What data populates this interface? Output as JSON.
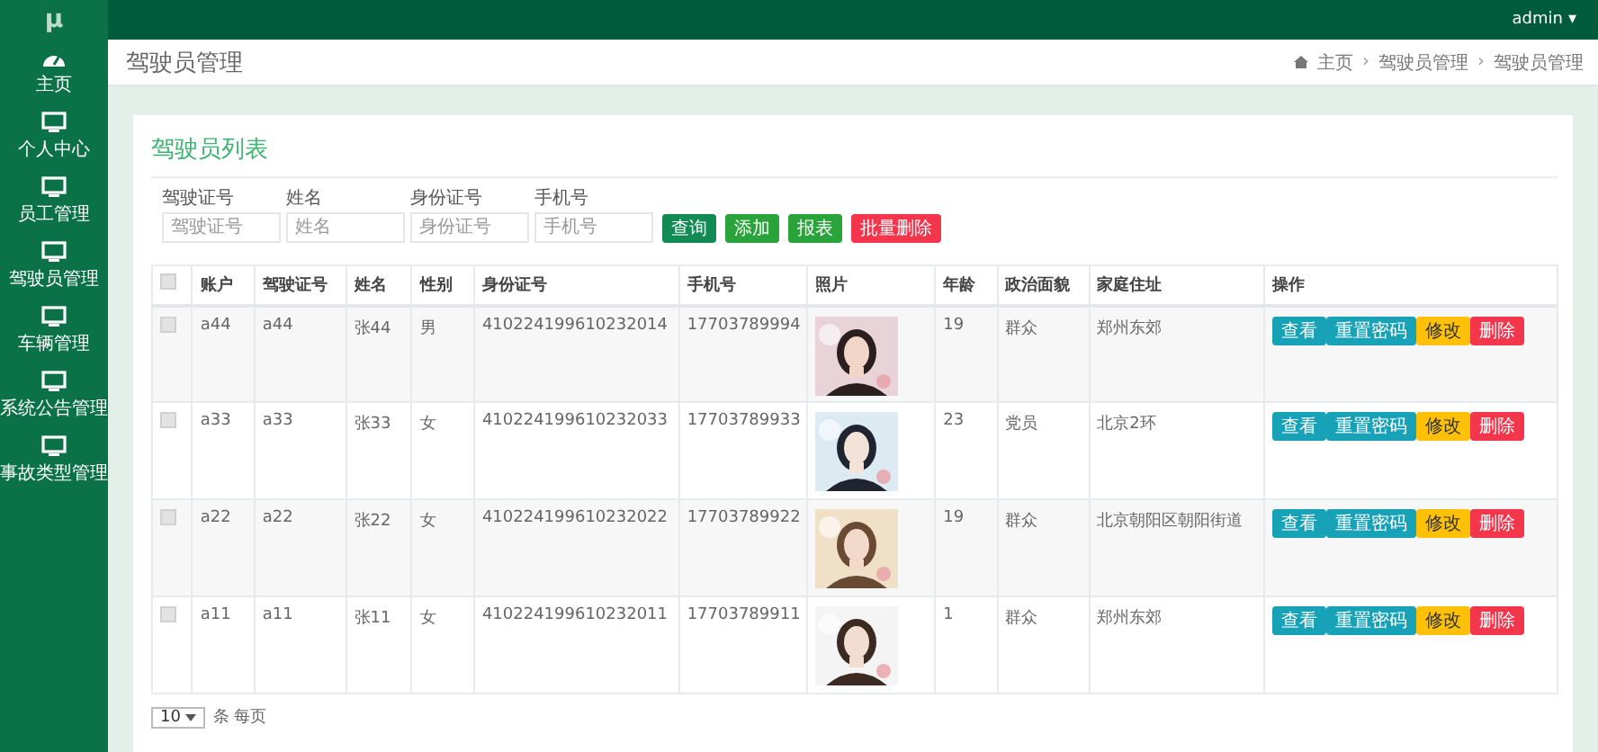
{
  "brand": "μ",
  "user": {
    "name": "admin",
    "caret": "▾"
  },
  "sidebar": [
    {
      "label": "主页",
      "kind": "dashboard"
    },
    {
      "label": "个人中心",
      "kind": "monitor"
    },
    {
      "label": "员工管理",
      "kind": "monitor"
    },
    {
      "label": "驾驶员管理",
      "kind": "monitor"
    },
    {
      "label": "车辆管理",
      "kind": "monitor"
    },
    {
      "label": "系统公告管理",
      "kind": "monitor"
    },
    {
      "label": "事故类型管理",
      "kind": "monitor"
    }
  ],
  "page_title": "驾驶员管理",
  "breadcrumb": {
    "separator": "›",
    "items": [
      "主页",
      "驾驶员管理",
      "驾驶员管理"
    ]
  },
  "card_title": "驾驶员列表",
  "filters": [
    {
      "label": "驾驶证号",
      "placeholder": "驾驶证号"
    },
    {
      "label": "姓名",
      "placeholder": "姓名"
    },
    {
      "label": "身份证号",
      "placeholder": "身份证号"
    },
    {
      "label": "手机号",
      "placeholder": "手机号"
    }
  ],
  "toolbar": [
    {
      "label": "查询",
      "kind": "dark"
    },
    {
      "label": "添加",
      "kind": "green"
    },
    {
      "label": "报表",
      "kind": "green"
    },
    {
      "label": "批量删除",
      "kind": "danger"
    }
  ],
  "table": {
    "select_all": {
      "checked": false
    },
    "columns": [
      "账户",
      "驾驶证号",
      "姓名",
      "性别",
      "身份证号",
      "手机号",
      "照片",
      "年龄",
      "政治面貌",
      "家庭住址",
      "操作"
    ],
    "rows": [
      {
        "checked": false,
        "cells": [
          "a44",
          "a44",
          "张44",
          "男",
          "410224199610232014",
          "17703789994"
        ],
        "photo": {
          "kind": "picture"
        },
        "tail": [
          "19",
          "群众",
          "郑州东郊"
        ],
        "actions": [
          {
            "label": "查看",
            "kind": "info"
          },
          {
            "label": "重置密码",
            "kind": "info"
          },
          {
            "label": "修改",
            "kind": "warning"
          },
          {
            "label": "删除",
            "kind": "danger"
          }
        ]
      },
      {
        "checked": false,
        "cells": [
          "a33",
          "a33",
          "张33",
          "女",
          "410224199610232033",
          "17703789933"
        ],
        "photo": {
          "kind": "picture"
        },
        "tail": [
          "23",
          "党员",
          "北京2环"
        ],
        "actions": [
          {
            "label": "查看",
            "kind": "info"
          },
          {
            "label": "重置密码",
            "kind": "info"
          },
          {
            "label": "修改",
            "kind": "warning"
          },
          {
            "label": "删除",
            "kind": "danger"
          }
        ]
      },
      {
        "checked": false,
        "cells": [
          "a22",
          "a22",
          "张22",
          "女",
          "410224199610232022",
          "17703789922"
        ],
        "photo": {
          "kind": "picture"
        },
        "tail": [
          "19",
          "群众",
          "北京朝阳区朝阳街道"
        ],
        "actions": [
          {
            "label": "查看",
            "kind": "info"
          },
          {
            "label": "重置密码",
            "kind": "info"
          },
          {
            "label": "修改",
            "kind": "warning"
          },
          {
            "label": "删除",
            "kind": "danger"
          }
        ]
      },
      {
        "checked": false,
        "cells": [
          "a11",
          "a11",
          "张11",
          "女",
          "410224199610232011",
          "17703789911"
        ],
        "photo": {
          "kind": "picture"
        },
        "tail": [
          "1",
          "群众",
          "郑州东郊"
        ],
        "actions": [
          {
            "label": "查看",
            "kind": "info"
          },
          {
            "label": "重置密码",
            "kind": "info"
          },
          {
            "label": "修改",
            "kind": "warning"
          },
          {
            "label": "删除",
            "kind": "danger"
          }
        ]
      }
    ]
  },
  "pagination": {
    "page_size": "10",
    "text": "条 每页"
  }
}
